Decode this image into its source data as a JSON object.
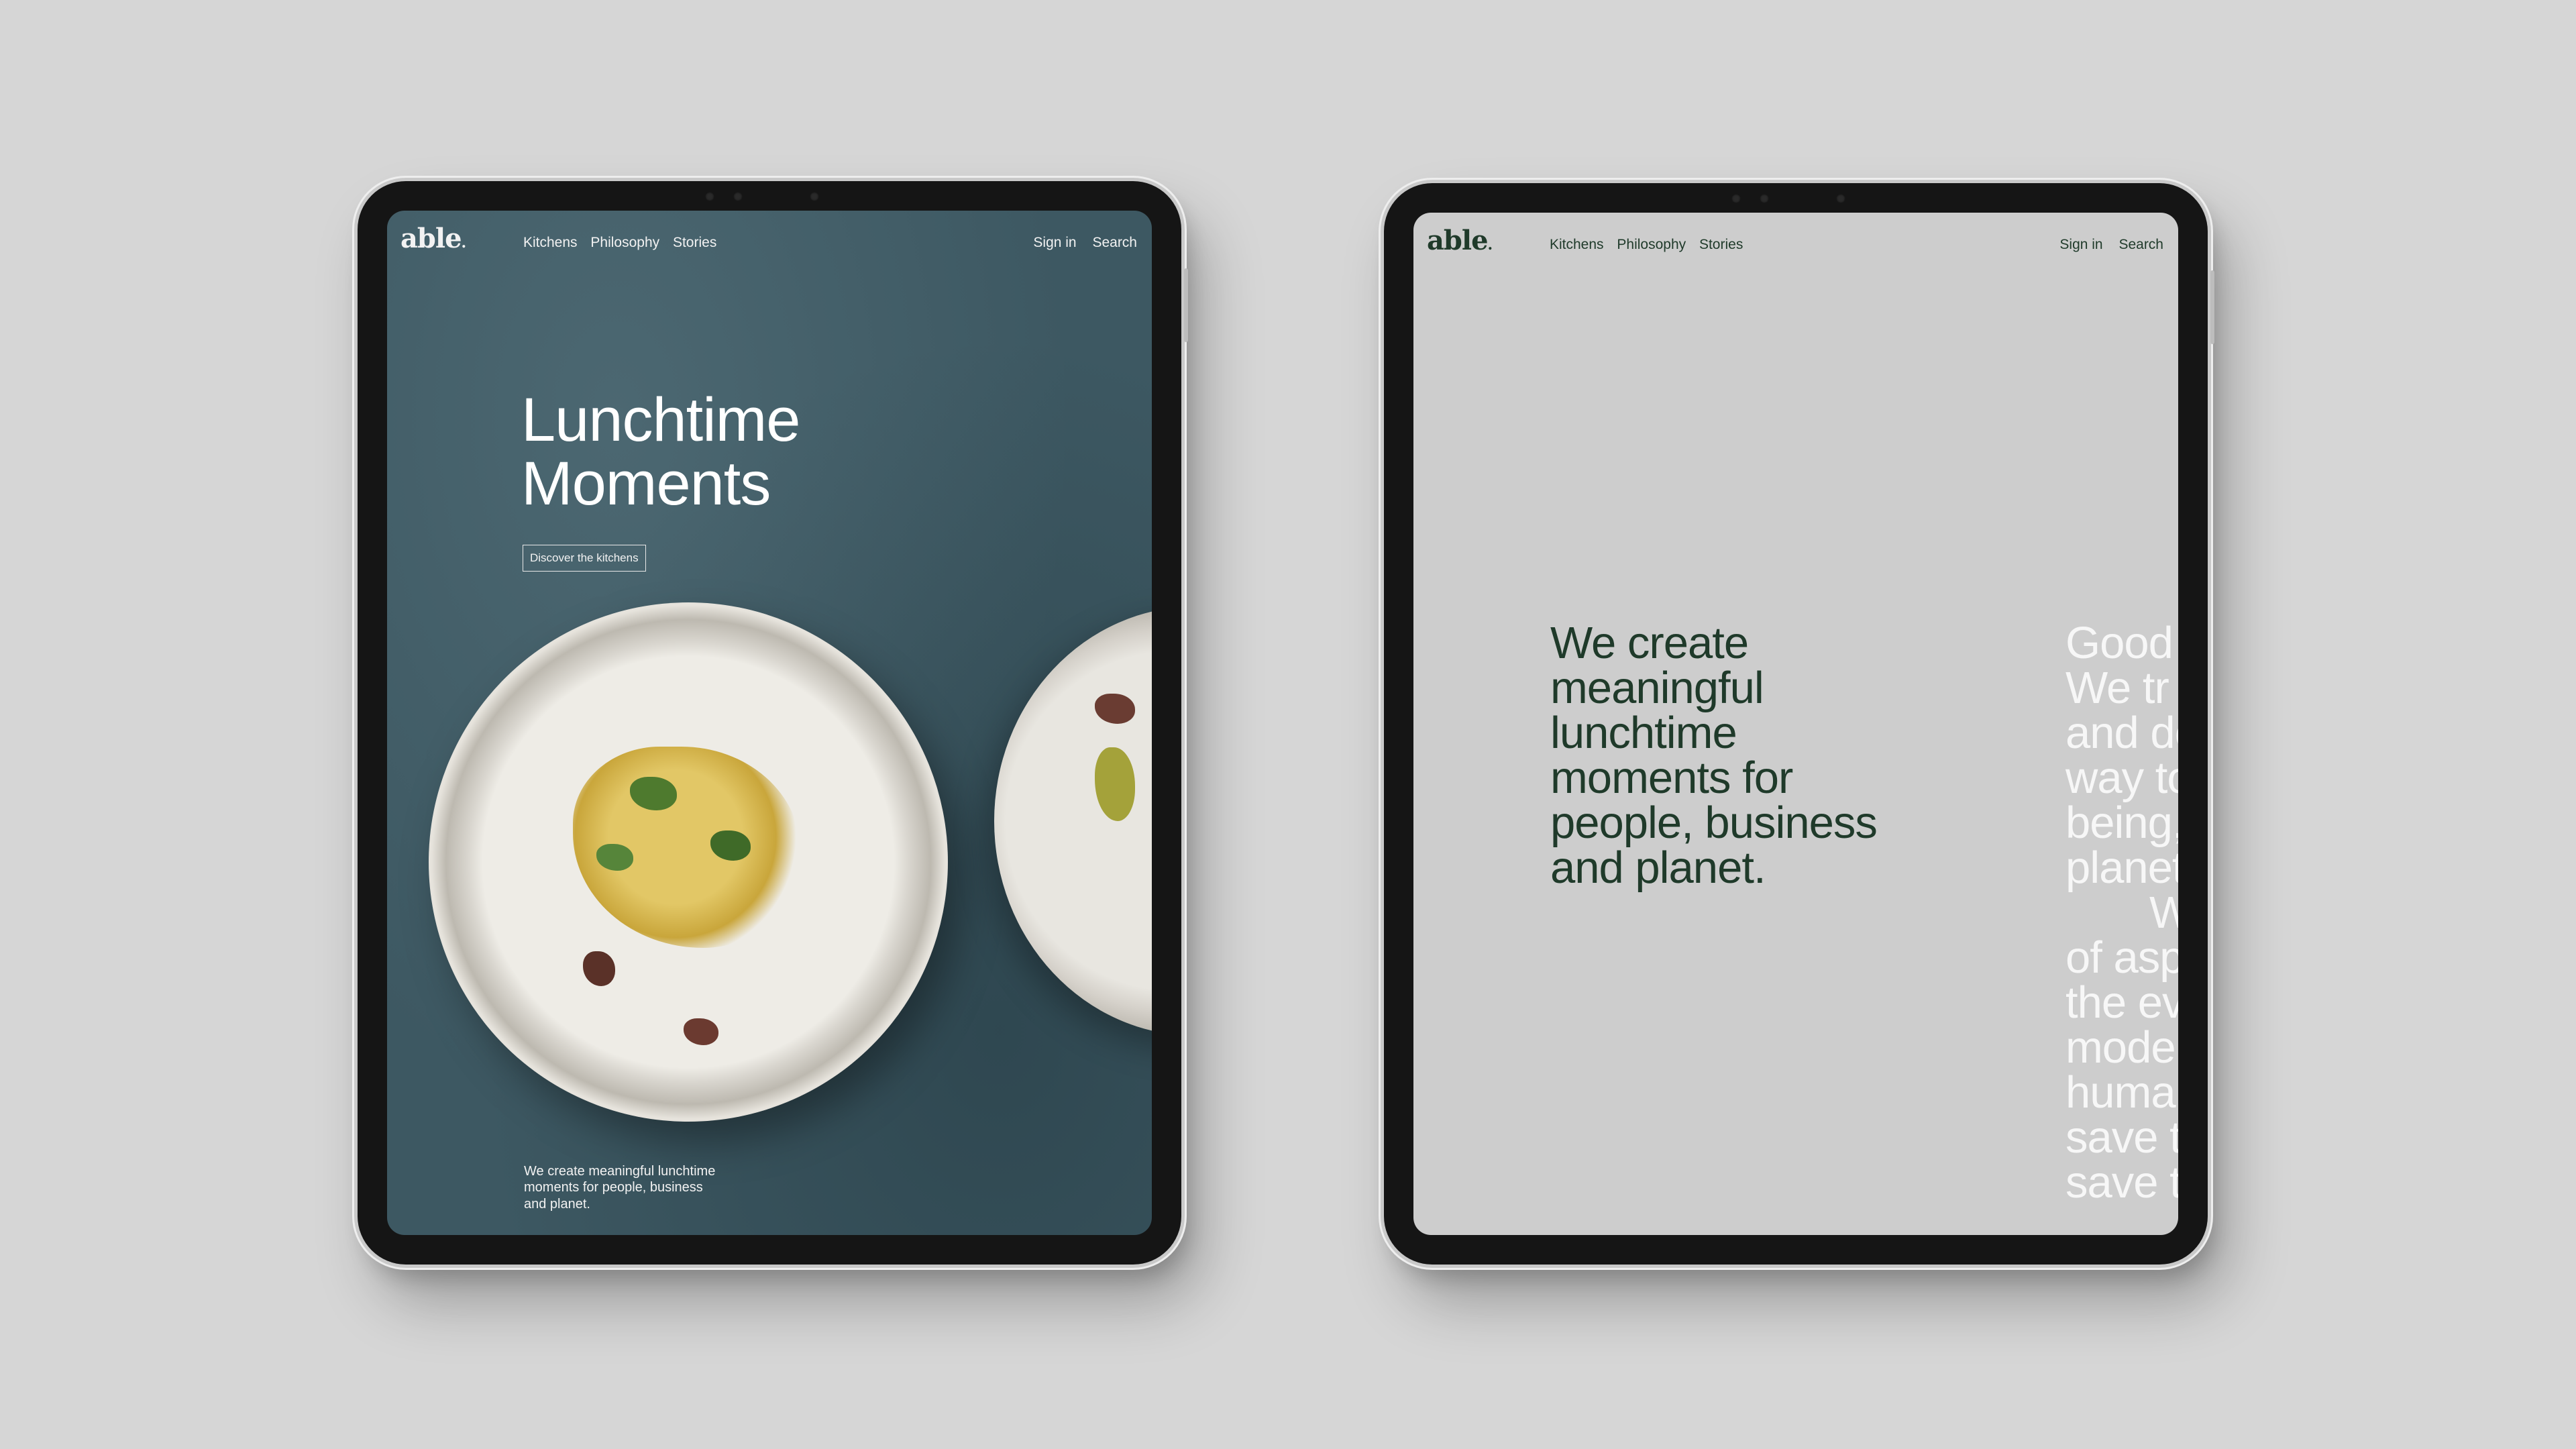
{
  "left_tablet": {
    "nav": {
      "logo": "able",
      "logo_dot": ".",
      "links": [
        "Kitchens",
        "Philosophy",
        "Stories"
      ],
      "sign_in": "Sign in",
      "search": "Search"
    },
    "hero_title_line1": "Lunchtime",
    "hero_title_line2": "Moments",
    "cta_label": "Discover the kitchens",
    "caption_line1": "We create meaningful lunchtime",
    "caption_line2": "moments for people, business",
    "caption_line3": "and planet."
  },
  "right_tablet": {
    "nav": {
      "logo": "able",
      "logo_dot": ".",
      "links": [
        "Kitchens",
        "Philosophy",
        "Stories"
      ],
      "sign_in": "Sign in",
      "search": "Search"
    },
    "statement_lines": [
      "We create",
      "meaningful",
      "lunchtime",
      "moments for",
      "people, business",
      "and planet."
    ],
    "overflow_lines": [
      "Good",
      "We tr",
      "and de",
      "way to",
      "being,",
      "planet",
      "W",
      "of asp",
      "the ev",
      "mode",
      "huma",
      "save t",
      "save t"
    ]
  },
  "colors": {
    "background": "#d6d6d6",
    "left_screen": "#3d5862",
    "right_screen": "#cdcdcd",
    "brand_green": "#1f3a2a"
  }
}
